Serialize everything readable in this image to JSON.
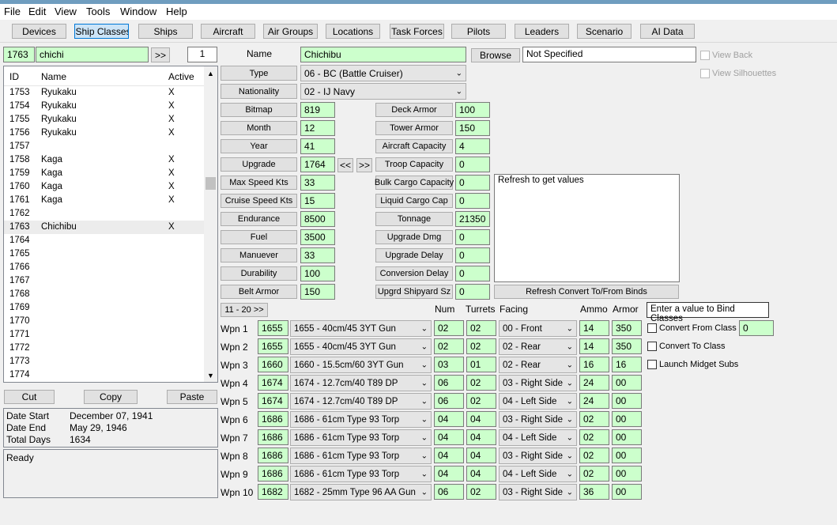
{
  "menu": [
    "File",
    "Edit",
    "View",
    "Tools",
    "Window",
    "Help"
  ],
  "tabs": [
    "Devices",
    "Ship Classes",
    "Ships",
    "Aircraft",
    "Air Groups",
    "Locations",
    "Task Forces",
    "Pilots",
    "Leaders",
    "Scenario",
    "AI Data"
  ],
  "selected_tab": "Ship Classes",
  "search": {
    "id": "1763",
    "text": "chichi",
    "go": ">>",
    "count": "1"
  },
  "list": {
    "headers": {
      "id": "ID",
      "name": "Name",
      "active": "Active"
    },
    "rows": [
      {
        "id": "1753",
        "name": "Ryukaku",
        "active": "X"
      },
      {
        "id": "1754",
        "name": "Ryukaku",
        "active": "X"
      },
      {
        "id": "1755",
        "name": "Ryukaku",
        "active": "X"
      },
      {
        "id": "1756",
        "name": "Ryukaku",
        "active": "X"
      },
      {
        "id": "1757",
        "name": "",
        "active": ""
      },
      {
        "id": "1758",
        "name": "Kaga",
        "active": "X"
      },
      {
        "id": "1759",
        "name": "Kaga",
        "active": "X"
      },
      {
        "id": "1760",
        "name": "Kaga",
        "active": "X"
      },
      {
        "id": "1761",
        "name": "Kaga",
        "active": "X"
      },
      {
        "id": "1762",
        "name": "",
        "active": ""
      },
      {
        "id": "1763",
        "name": "Chichibu",
        "active": "X"
      },
      {
        "id": "1764",
        "name": "",
        "active": ""
      },
      {
        "id": "1765",
        "name": "",
        "active": ""
      },
      {
        "id": "1766",
        "name": "",
        "active": ""
      },
      {
        "id": "1767",
        "name": "",
        "active": ""
      },
      {
        "id": "1768",
        "name": "",
        "active": ""
      },
      {
        "id": "1769",
        "name": "",
        "active": ""
      },
      {
        "id": "1770",
        "name": "",
        "active": ""
      },
      {
        "id": "1771",
        "name": "",
        "active": ""
      },
      {
        "id": "1772",
        "name": "",
        "active": ""
      },
      {
        "id": "1773",
        "name": "",
        "active": ""
      },
      {
        "id": "1774",
        "name": "",
        "active": ""
      }
    ],
    "selected_id": "1763"
  },
  "clipboard": {
    "cut": "Cut",
    "copy": "Copy",
    "paste": "Paste"
  },
  "dates": {
    "start_label": "Date Start",
    "start": "December 07, 1941",
    "end_label": "Date End",
    "end": "May 29, 1946",
    "days_label": "Total Days",
    "days": "1634"
  },
  "status": "Ready",
  "name": {
    "label": "Name",
    "value": "Chichibu",
    "browse": "Browse",
    "file": "Not Specified"
  },
  "type": {
    "label": "Type",
    "value": "06 - BC (Battle Cruiser)"
  },
  "nationality": {
    "label": "Nationality",
    "value": "02 - IJ Navy"
  },
  "view_back": "View Back",
  "view_silhouettes": "View Silhouettes",
  "left_fields": [
    {
      "label": "Bitmap",
      "value": "819"
    },
    {
      "label": "Month",
      "value": "12"
    },
    {
      "label": "Year",
      "value": "41"
    },
    {
      "label": "Upgrade",
      "value": "1764"
    },
    {
      "label": "Max Speed Kts",
      "value": "33"
    },
    {
      "label": "Cruise Speed Kts",
      "value": "15"
    },
    {
      "label": "Endurance",
      "value": "8500"
    },
    {
      "label": "Fuel",
      "value": "3500"
    },
    {
      "label": "Manuever",
      "value": "33"
    },
    {
      "label": "Durability",
      "value": "100"
    },
    {
      "label": "Belt Armor",
      "value": "150"
    }
  ],
  "upgrade_nav": {
    "prev": "<<",
    "next": ">>"
  },
  "right_fields": [
    {
      "label": "Deck Armor",
      "value": "100"
    },
    {
      "label": "Tower Armor",
      "value": "150"
    },
    {
      "label": "Aircraft Capacity",
      "value": "4"
    },
    {
      "label": "Troop Capacity",
      "value": "0"
    },
    {
      "label": "Bulk Cargo Capacity",
      "value": "0"
    },
    {
      "label": "Liquid Cargo Cap",
      "value": "0"
    },
    {
      "label": "Tonnage",
      "value": "21350"
    },
    {
      "label": "Upgrade Dmg",
      "value": "0"
    },
    {
      "label": "Upgrade Delay",
      "value": "0"
    },
    {
      "label": "Conversion Delay",
      "value": "0"
    },
    {
      "label": "Upgrd Shipyard Sz",
      "value": "0"
    }
  ],
  "values_box": "Refresh to get values",
  "refresh_button": "Refresh Convert To/From Binds",
  "weapons_page": "11 - 20  >>",
  "weapon_headers": {
    "num": "Num",
    "turrets": "Turrets",
    "facing": "Facing",
    "ammo": "Ammo",
    "armor": "Armor"
  },
  "weapons": [
    {
      "label": "Wpn 1",
      "id": "1655",
      "device": "1655 - 40cm/45 3YT Gun",
      "num": "02",
      "turrets": "02",
      "facing": "00 - Front",
      "ammo": "14",
      "armor": "350"
    },
    {
      "label": "Wpn 2",
      "id": "1655",
      "device": "1655 - 40cm/45 3YT Gun",
      "num": "02",
      "turrets": "02",
      "facing": "02 - Rear",
      "ammo": "14",
      "armor": "350"
    },
    {
      "label": "Wpn 3",
      "id": "1660",
      "device": "1660 - 15.5cm/60 3YT Gun",
      "num": "03",
      "turrets": "01",
      "facing": "02 - Rear",
      "ammo": "16",
      "armor": "16"
    },
    {
      "label": "Wpn 4",
      "id": "1674",
      "device": "1674 - 12.7cm/40 T89 DP",
      "num": "06",
      "turrets": "02",
      "facing": "03 - Right Side",
      "ammo": "24",
      "armor": "00"
    },
    {
      "label": "Wpn 5",
      "id": "1674",
      "device": "1674 - 12.7cm/40 T89 DP",
      "num": "06",
      "turrets": "02",
      "facing": "04 - Left Side",
      "ammo": "24",
      "armor": "00"
    },
    {
      "label": "Wpn 6",
      "id": "1686",
      "device": "1686 - 61cm Type 93 Torp",
      "num": "04",
      "turrets": "04",
      "facing": "03 - Right Side",
      "ammo": "02",
      "armor": "00"
    },
    {
      "label": "Wpn 7",
      "id": "1686",
      "device": "1686 - 61cm Type 93 Torp",
      "num": "04",
      "turrets": "04",
      "facing": "04 - Left Side",
      "ammo": "02",
      "armor": "00"
    },
    {
      "label": "Wpn 8",
      "id": "1686",
      "device": "1686 - 61cm Type 93 Torp",
      "num": "04",
      "turrets": "04",
      "facing": "03 - Right Side",
      "ammo": "02",
      "armor": "00"
    },
    {
      "label": "Wpn 9",
      "id": "1686",
      "device": "1686 - 61cm Type 93 Torp",
      "num": "04",
      "turrets": "04",
      "facing": "04 - Left Side",
      "ammo": "02",
      "armor": "00"
    },
    {
      "label": "Wpn 10",
      "id": "1682",
      "device": "1682 - 25mm Type 96 AA Gun",
      "num": "06",
      "turrets": "02",
      "facing": "03 - Right Side",
      "ammo": "36",
      "armor": "00"
    }
  ],
  "bind": {
    "header": "Enter a value to Bind Classes",
    "convert_from": "Convert From Class",
    "convert_from_value": "0",
    "convert_to": "Convert To Class",
    "launch_midget": "Launch Midget Subs"
  }
}
